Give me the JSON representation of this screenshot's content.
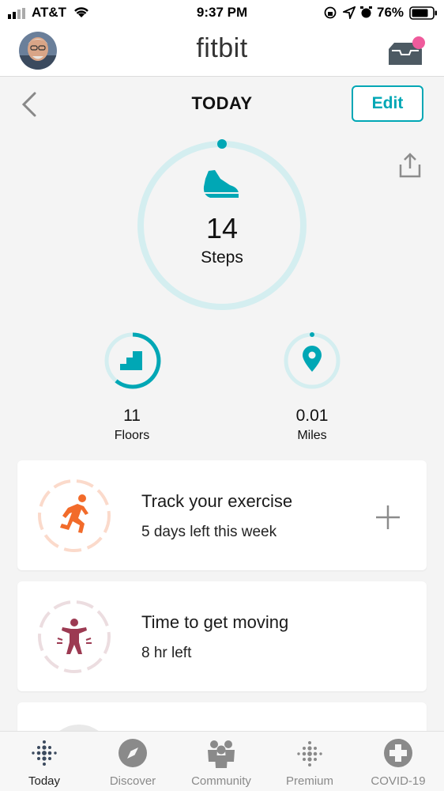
{
  "status_bar": {
    "carrier": "AT&T",
    "time": "9:37 PM",
    "battery": "76%"
  },
  "header": {
    "logo": "fitbit"
  },
  "subheader": {
    "title": "TODAY",
    "edit_label": "Edit"
  },
  "steps": {
    "value": "14",
    "label": "Steps"
  },
  "floors": {
    "value": "11",
    "label": "Floors"
  },
  "miles": {
    "value": "0.01",
    "label": "Miles"
  },
  "cards": [
    {
      "title": "Track your exercise",
      "subtitle": "5 days left this week"
    },
    {
      "title": "Time to get moving",
      "subtitle": "8 hr left"
    }
  ],
  "nav": [
    {
      "label": "Today"
    },
    {
      "label": "Discover"
    },
    {
      "label": "Community"
    },
    {
      "label": "Premium"
    },
    {
      "label": "COVID-19"
    }
  ],
  "colors": {
    "accent": "#00a7b5",
    "exercise": "#f26b2a",
    "moving": "#9c3a52",
    "notification": "#ef5b9c"
  }
}
